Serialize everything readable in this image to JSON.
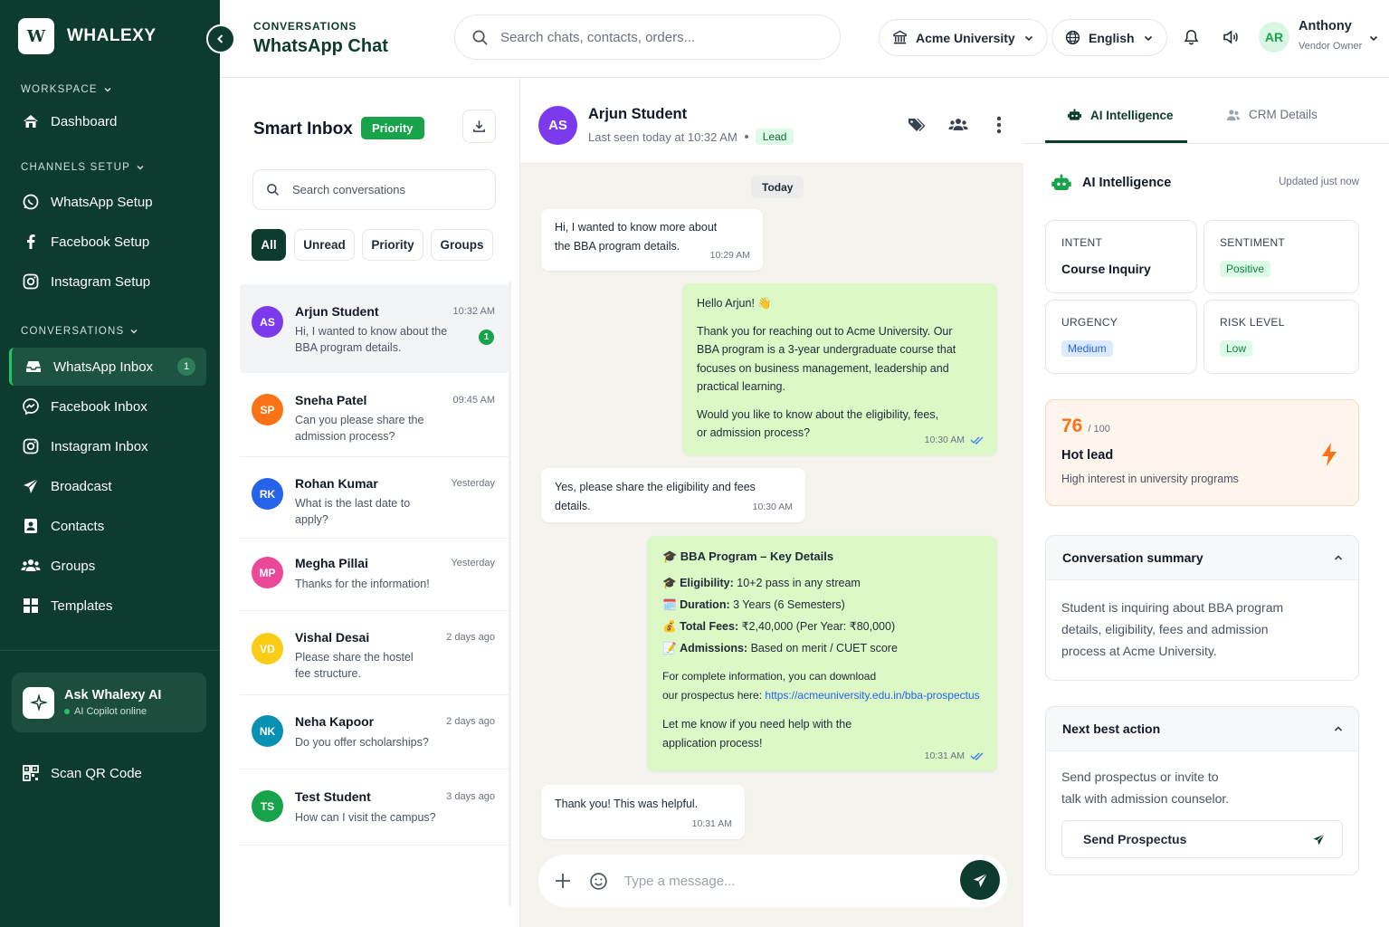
{
  "brand": {
    "logo_letter": "W",
    "name": "WHALEXY"
  },
  "sidebar": {
    "sections": {
      "workspace": "WORKSPACE",
      "channels": "CHANNELS SETUP",
      "conversations": "CONVERSATIONS"
    },
    "items": [
      {
        "label": "Dashboard",
        "icon": "home-icon"
      },
      {
        "label": "WhatsApp Setup",
        "icon": "whatsapp-icon"
      },
      {
        "label": "Facebook Setup",
        "icon": "facebook-icon"
      },
      {
        "label": "Instagram Setup",
        "icon": "instagram-icon"
      },
      {
        "label": "WhatsApp Inbox",
        "icon": "inbox-icon",
        "badge": "1",
        "active": true
      },
      {
        "label": "Facebook Inbox",
        "icon": "messenger-icon"
      },
      {
        "label": "Instagram Inbox",
        "icon": "instagram-icon"
      },
      {
        "label": "Broadcast",
        "icon": "send-icon"
      },
      {
        "label": "Contacts",
        "icon": "contact-icon"
      },
      {
        "label": "Groups",
        "icon": "users-icon"
      },
      {
        "label": "Templates",
        "icon": "grid-icon"
      }
    ],
    "ask_ai": {
      "title": "Ask Whalexy AI",
      "status": "AI Copilot online"
    },
    "scan_qr": "Scan QR Code"
  },
  "topbar": {
    "breadcrumb": "CONVERSATIONS",
    "title": "WhatsApp Chat",
    "search_placeholder": "Search chats, contacts, orders...",
    "org": "Acme University",
    "language": "English",
    "user": {
      "initials": "AR",
      "name": "Anthony",
      "role": "Vendor Owner"
    }
  },
  "inbox": {
    "title": "Smart Inbox",
    "badge": "Priority",
    "search_placeholder": "Search conversations",
    "filters": [
      "All",
      "Unread",
      "Priority",
      "Groups"
    ],
    "conversations": [
      {
        "initials": "AS",
        "name": "Arjun Student",
        "time": "10:32 AM",
        "preview": "Hi, I wanted to know about the BBA program details.",
        "unread": "1",
        "color": "#7c3aed"
      },
      {
        "initials": "SP",
        "name": "Sneha Patel",
        "time": "09:45 AM",
        "preview": "Can you please share the admission process?",
        "color": "#f97316"
      },
      {
        "initials": "RK",
        "name": "Rohan Kumar",
        "time": "Yesterday",
        "preview": "What is the last date to apply?",
        "color": "#2563eb"
      },
      {
        "initials": "MP",
        "name": "Megha Pillai",
        "time": "Yesterday",
        "preview": "Thanks for the information!",
        "color": "#ec4899"
      },
      {
        "initials": "VD",
        "name": "Vishal Desai",
        "time": "2 days ago",
        "preview": "Please share the hostel fee structure.",
        "color": "#facc15"
      },
      {
        "initials": "NK",
        "name": "Neha Kapoor",
        "time": "2 days ago",
        "preview": "Do you offer scholarships?",
        "color": "#0891b2"
      },
      {
        "initials": "TS",
        "name": "Test Student",
        "time": "3 days ago",
        "preview": "How can I visit the campus?",
        "color": "#16a34a"
      }
    ]
  },
  "chat": {
    "contact": {
      "initials": "AS",
      "name": "Arjun Student",
      "last_seen": "Last seen today at 10:32 AM",
      "tag": "Lead"
    },
    "date_chip": "Today",
    "messages": {
      "m1": {
        "text": "Hi, I wanted to know more about the BBA program details.",
        "time": "10:29 AM"
      },
      "m2": {
        "greeting": "Hello Arjun! 👋",
        "p1": "Thank you for reaching out to Acme University. Our BBA program is a 3-year undergraduate course that focuses on business management, leadership and practical learning.",
        "p2": "Would you like to know about the eligibility, fees, or admission process?",
        "time": "10:30 AM"
      },
      "m3": {
        "text": "Yes, please share the eligibility and fees details.",
        "time": "10:30 AM"
      },
      "m4": {
        "title": "🎓 BBA Program – Key Details",
        "rows": [
          {
            "emoji": "🎓",
            "label": "Eligibility:",
            "value": "10+2 pass in any stream"
          },
          {
            "emoji": "🗓️",
            "label": "Duration:",
            "value": "3 Years (6 Semesters)"
          },
          {
            "emoji": "💰",
            "label": "Total Fees:",
            "value": "₹2,40,000 (Per Year: ₹80,000)"
          },
          {
            "emoji": "📝",
            "label": "Admissions:",
            "value": "Based on merit / CUET score"
          }
        ],
        "info1": "For complete information, you can download",
        "info2": "our prospectus here: ",
        "link": "https://acmeuniversity.edu.in/bba-prospectus",
        "closing": "Let me know if you need help with the application process!",
        "time": "10:31 AM"
      },
      "m5": {
        "text": "Thank you! This was helpful.",
        "time": "10:31 AM"
      }
    },
    "composer_placeholder": "Type a message..."
  },
  "right": {
    "tabs": [
      "AI Intelligence",
      "CRM Details"
    ],
    "heading": "AI Intelligence",
    "updated": "Updated just now",
    "intent": {
      "label": "INTENT",
      "value": "Course Inquiry"
    },
    "sentiment": {
      "label": "SENTIMENT",
      "value": "Positive"
    },
    "urgency": {
      "label": "URGENCY",
      "value": "Medium"
    },
    "risk": {
      "label": "RISK LEVEL",
      "value": "Low"
    },
    "lead_score": {
      "score": "76",
      "max": "/ 100",
      "title": "Hot lead",
      "desc": "High interest in university programs"
    },
    "summary": {
      "title": "Conversation summary",
      "text": "Student is inquiring about BBA program details, eligibility, fees and admission process at Acme University."
    },
    "next_action": {
      "title": "Next best action",
      "text": "Send prospectus or invite to talk with admission counselor.",
      "button": "Send Prospectus"
    }
  },
  "colors": {
    "brand": "#0d3b2e",
    "accent": "#16a34a",
    "hot": "#f97316"
  }
}
